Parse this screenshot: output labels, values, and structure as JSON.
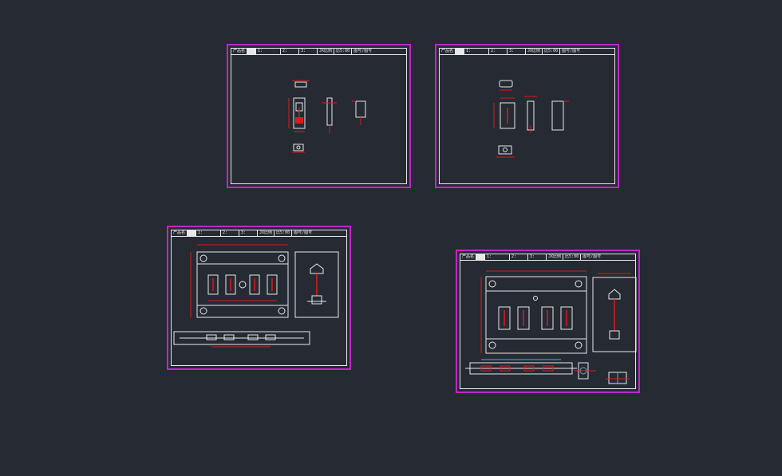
{
  "title_block": {
    "c1": "产品名",
    "c2": "1:",
    "c3": "2:",
    "c4": "3:",
    "c5": "JX比例",
    "c6": "比5:00",
    "c7": "图号/图号"
  },
  "colors": {
    "background": "#252a33",
    "sheet_border": "#c026c8",
    "frame_line": "#e8e8e8",
    "dimension": "#e01a1a"
  }
}
